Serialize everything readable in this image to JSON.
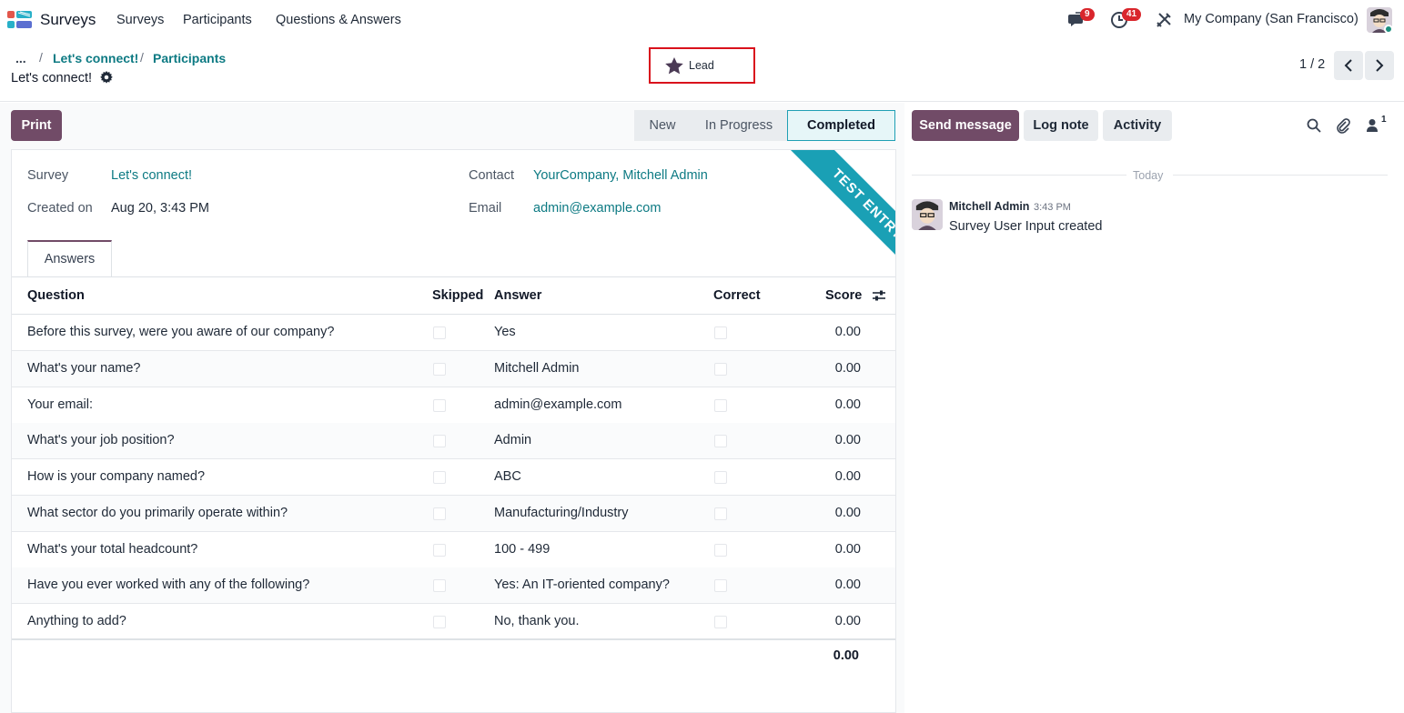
{
  "navbar": {
    "app_name": "Surveys",
    "menu": [
      "Surveys",
      "Participants",
      "Questions & Answers"
    ],
    "messages_count": "9",
    "activities_count": "41",
    "company": "My Company (San Francisco)"
  },
  "breadcrumb": {
    "dots": "...",
    "separator": "/",
    "items": [
      "Let's connect!",
      "Participants"
    ],
    "current": "Let's connect!"
  },
  "lead_button": {
    "label": "Lead"
  },
  "pager": {
    "text": "1 / 2"
  },
  "actions": {
    "print": "Print"
  },
  "statusbar": {
    "stages": [
      "New",
      "In Progress",
      "Completed"
    ],
    "active": "Completed"
  },
  "form": {
    "survey_label": "Survey",
    "survey_value": "Let's connect!",
    "created_label": "Created on",
    "created_value": "Aug 20, 3:43 PM",
    "contact_label": "Contact",
    "contact_value": "YourCompany, Mitchell Admin",
    "email_label": "Email",
    "email_value": "admin@example.com",
    "ribbon": "TEST ENTRY"
  },
  "tabs": [
    "Answers"
  ],
  "table": {
    "headers": {
      "question": "Question",
      "skipped": "Skipped",
      "answer": "Answer",
      "correct": "Correct",
      "score": "Score"
    },
    "rows": [
      {
        "question": "Before this survey, were you aware of our company?",
        "answer": "Yes",
        "score": "0.00"
      },
      {
        "question": "What's your name?",
        "answer": "Mitchell Admin",
        "score": "0.00"
      },
      {
        "question": "Your email:",
        "answer": "admin@example.com",
        "score": "0.00"
      },
      {
        "question": "What's your job position?",
        "answer": "Admin",
        "score": "0.00"
      },
      {
        "question": "How is your company named?",
        "answer": "ABC",
        "score": "0.00"
      },
      {
        "question": "What sector do you primarily operate within?",
        "answer": "Manufacturing/Industry",
        "score": "0.00"
      },
      {
        "question": "What's your total headcount?",
        "answer": "100 - 499",
        "score": "0.00"
      },
      {
        "question": "Have you ever worked with any of the following?",
        "answer": "Yes: An IT-oriented company?",
        "score": "0.00"
      },
      {
        "question": "Anything to add?",
        "answer": "No, thank you.",
        "score": "0.00"
      }
    ],
    "total": "0.00"
  },
  "chatter": {
    "send_message": "Send message",
    "log_note": "Log note",
    "activity": "Activity",
    "followers_count": "1",
    "date_separator": "Today",
    "message": {
      "author": "Mitchell Admin",
      "time": "3:43 PM",
      "body": "Survey User Input created"
    }
  },
  "colors": {
    "brand": "#714b67",
    "link": "#0d7a83",
    "ribbon": "#1aa0b5",
    "highlight": "#d9111c"
  }
}
